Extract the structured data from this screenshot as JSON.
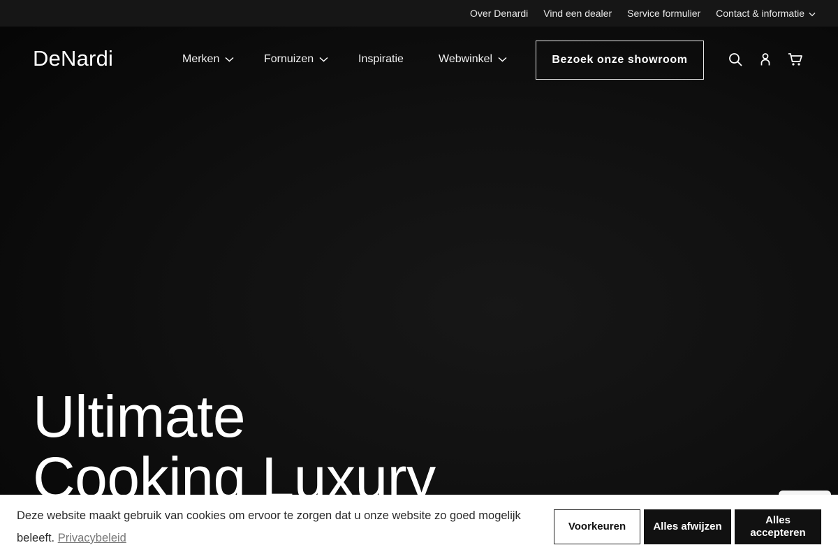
{
  "topbar": {
    "links": [
      "Over Denardi",
      "Vind een dealer",
      "Service formulier",
      "Contact & informatie"
    ]
  },
  "header": {
    "logo": "DeNardi",
    "nav": [
      "Merken",
      "Fornuizen",
      "Inspiratie",
      "Webwinkel"
    ],
    "cta": "Bezoek onze showroom",
    "icons": [
      "search-icon",
      "user-icon",
      "cart-icon"
    ]
  },
  "hero": {
    "line1": "Ultimate",
    "line2": "Cooking Luxury"
  },
  "cookie": {
    "text": "Deze website maakt gebruik van cookies om ervoor te zorgen dat u onze website zo goed mogelijk beleeft.",
    "link": "Privacybeleid",
    "buttons": {
      "preferences": "Voorkeuren",
      "reject": "Alles afwijzen",
      "accept": "Alles accepteren"
    }
  },
  "colors": {
    "topbar_bg": "#161616",
    "hero_bg": "#101010",
    "cookie_bg": "#ffffff",
    "button_dark": "#111111"
  }
}
